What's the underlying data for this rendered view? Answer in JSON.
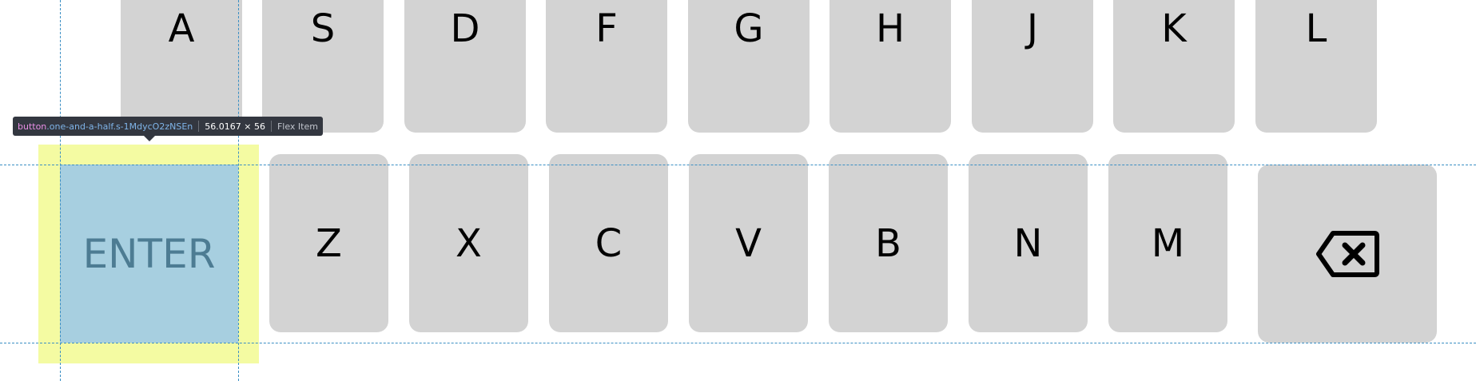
{
  "keyboard": {
    "row1": [
      "A",
      "S",
      "D",
      "F",
      "G",
      "H",
      "J",
      "K",
      "L"
    ],
    "row2": {
      "enter_label": "ENTER",
      "letters": [
        "Z",
        "X",
        "C",
        "V",
        "B",
        "N",
        "M"
      ],
      "backspace_icon": "backspace-icon"
    }
  },
  "devtools": {
    "tooltip": {
      "tag": "button",
      "class": ".one-and-a-half.s-1MdycO2zNSEn",
      "dimensions": "56.0167 × 56",
      "kind": "Flex Item"
    }
  },
  "colors": {
    "key_background": "#d3d3d3",
    "highlight_content": "#a7cfe0",
    "highlight_margin": "#f4fba2",
    "guide_line": "#3b8fc4",
    "tooltip_background": "#333740"
  }
}
